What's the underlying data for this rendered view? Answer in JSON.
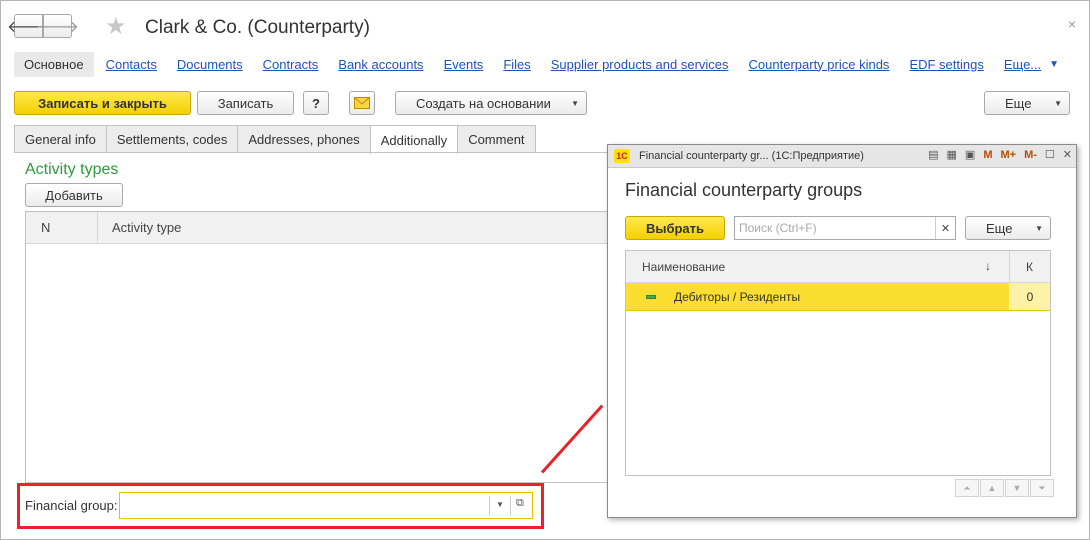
{
  "window": {
    "title": "Clark & Co. (Counterparty)",
    "close_symbol": "×"
  },
  "nav": {
    "back": "🡐",
    "forward": "🡒",
    "items": [
      {
        "label": "Основное"
      },
      {
        "label": "Contacts"
      },
      {
        "label": "Documents"
      },
      {
        "label": "Contracts"
      },
      {
        "label": "Bank accounts"
      },
      {
        "label": "Events"
      },
      {
        "label": "Files"
      },
      {
        "label": "Supplier products and services"
      },
      {
        "label": "Counterparty price kinds"
      },
      {
        "label": "EDF settings"
      }
    ],
    "more_label": "Еще..."
  },
  "toolbar": {
    "save_close": "Записать и закрыть",
    "save": "Записать",
    "help": "?",
    "create_based": "Создать на основании",
    "more": "Еще"
  },
  "tabs": [
    {
      "label": "General info"
    },
    {
      "label": "Settlements, codes"
    },
    {
      "label": "Addresses, phones"
    },
    {
      "label": "Additionally"
    },
    {
      "label": "Comment"
    }
  ],
  "activity": {
    "title": "Activity types",
    "add_button": "Добавить",
    "columns": [
      "N",
      "Activity type"
    ]
  },
  "financial_group": {
    "label": "Financial group:",
    "value": ""
  },
  "dialog": {
    "window_title": "Financial counterparty gr...  (1С:Предприятие)",
    "logo": "1С",
    "heading": "Financial counterparty groups",
    "select_button": "Выбрать",
    "search_placeholder": "Поиск (Ctrl+F)",
    "more": "Еще",
    "columns": {
      "name": "Наименование",
      "k": "К"
    },
    "rows": [
      {
        "name": "Дебиторы / Резиденты",
        "k": "0"
      }
    ],
    "titlebar_icons": [
      "print-icon",
      "calculator-icon",
      "calendar-icon",
      "M",
      "M+",
      "M-",
      "maximize-icon",
      "close-icon"
    ]
  },
  "colors": {
    "accent_yellow": "#f3d000",
    "link": "#1a56b8",
    "section_green": "#2d9b3a",
    "highlight_red": "#e8232a"
  }
}
